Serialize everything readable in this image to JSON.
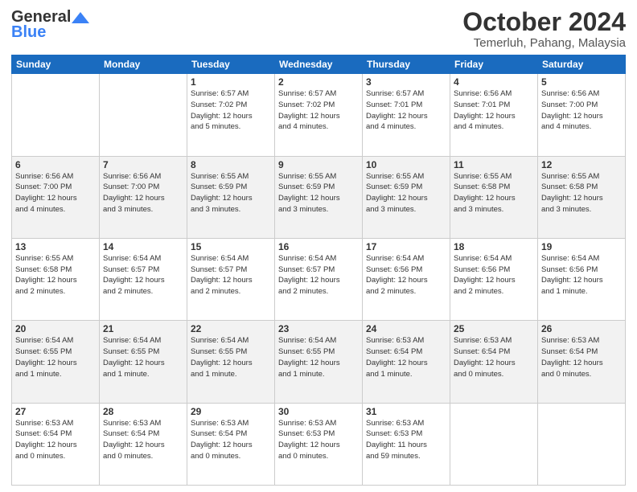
{
  "header": {
    "logo_general": "General",
    "logo_blue": "Blue",
    "month": "October 2024",
    "location": "Temerluh, Pahang, Malaysia"
  },
  "weekdays": [
    "Sunday",
    "Monday",
    "Tuesday",
    "Wednesday",
    "Thursday",
    "Friday",
    "Saturday"
  ],
  "weeks": [
    [
      {
        "day": "",
        "info": ""
      },
      {
        "day": "",
        "info": ""
      },
      {
        "day": "1",
        "info": "Sunrise: 6:57 AM\nSunset: 7:02 PM\nDaylight: 12 hours\nand 5 minutes."
      },
      {
        "day": "2",
        "info": "Sunrise: 6:57 AM\nSunset: 7:02 PM\nDaylight: 12 hours\nand 4 minutes."
      },
      {
        "day": "3",
        "info": "Sunrise: 6:57 AM\nSunset: 7:01 PM\nDaylight: 12 hours\nand 4 minutes."
      },
      {
        "day": "4",
        "info": "Sunrise: 6:56 AM\nSunset: 7:01 PM\nDaylight: 12 hours\nand 4 minutes."
      },
      {
        "day": "5",
        "info": "Sunrise: 6:56 AM\nSunset: 7:00 PM\nDaylight: 12 hours\nand 4 minutes."
      }
    ],
    [
      {
        "day": "6",
        "info": "Sunrise: 6:56 AM\nSunset: 7:00 PM\nDaylight: 12 hours\nand 4 minutes."
      },
      {
        "day": "7",
        "info": "Sunrise: 6:56 AM\nSunset: 7:00 PM\nDaylight: 12 hours\nand 3 minutes."
      },
      {
        "day": "8",
        "info": "Sunrise: 6:55 AM\nSunset: 6:59 PM\nDaylight: 12 hours\nand 3 minutes."
      },
      {
        "day": "9",
        "info": "Sunrise: 6:55 AM\nSunset: 6:59 PM\nDaylight: 12 hours\nand 3 minutes."
      },
      {
        "day": "10",
        "info": "Sunrise: 6:55 AM\nSunset: 6:59 PM\nDaylight: 12 hours\nand 3 minutes."
      },
      {
        "day": "11",
        "info": "Sunrise: 6:55 AM\nSunset: 6:58 PM\nDaylight: 12 hours\nand 3 minutes."
      },
      {
        "day": "12",
        "info": "Sunrise: 6:55 AM\nSunset: 6:58 PM\nDaylight: 12 hours\nand 3 minutes."
      }
    ],
    [
      {
        "day": "13",
        "info": "Sunrise: 6:55 AM\nSunset: 6:58 PM\nDaylight: 12 hours\nand 2 minutes."
      },
      {
        "day": "14",
        "info": "Sunrise: 6:54 AM\nSunset: 6:57 PM\nDaylight: 12 hours\nand 2 minutes."
      },
      {
        "day": "15",
        "info": "Sunrise: 6:54 AM\nSunset: 6:57 PM\nDaylight: 12 hours\nand 2 minutes."
      },
      {
        "day": "16",
        "info": "Sunrise: 6:54 AM\nSunset: 6:57 PM\nDaylight: 12 hours\nand 2 minutes."
      },
      {
        "day": "17",
        "info": "Sunrise: 6:54 AM\nSunset: 6:56 PM\nDaylight: 12 hours\nand 2 minutes."
      },
      {
        "day": "18",
        "info": "Sunrise: 6:54 AM\nSunset: 6:56 PM\nDaylight: 12 hours\nand 2 minutes."
      },
      {
        "day": "19",
        "info": "Sunrise: 6:54 AM\nSunset: 6:56 PM\nDaylight: 12 hours\nand 1 minute."
      }
    ],
    [
      {
        "day": "20",
        "info": "Sunrise: 6:54 AM\nSunset: 6:55 PM\nDaylight: 12 hours\nand 1 minute."
      },
      {
        "day": "21",
        "info": "Sunrise: 6:54 AM\nSunset: 6:55 PM\nDaylight: 12 hours\nand 1 minute."
      },
      {
        "day": "22",
        "info": "Sunrise: 6:54 AM\nSunset: 6:55 PM\nDaylight: 12 hours\nand 1 minute."
      },
      {
        "day": "23",
        "info": "Sunrise: 6:54 AM\nSunset: 6:55 PM\nDaylight: 12 hours\nand 1 minute."
      },
      {
        "day": "24",
        "info": "Sunrise: 6:53 AM\nSunset: 6:54 PM\nDaylight: 12 hours\nand 1 minute."
      },
      {
        "day": "25",
        "info": "Sunrise: 6:53 AM\nSunset: 6:54 PM\nDaylight: 12 hours\nand 0 minutes."
      },
      {
        "day": "26",
        "info": "Sunrise: 6:53 AM\nSunset: 6:54 PM\nDaylight: 12 hours\nand 0 minutes."
      }
    ],
    [
      {
        "day": "27",
        "info": "Sunrise: 6:53 AM\nSunset: 6:54 PM\nDaylight: 12 hours\nand 0 minutes."
      },
      {
        "day": "28",
        "info": "Sunrise: 6:53 AM\nSunset: 6:54 PM\nDaylight: 12 hours\nand 0 minutes."
      },
      {
        "day": "29",
        "info": "Sunrise: 6:53 AM\nSunset: 6:54 PM\nDaylight: 12 hours\nand 0 minutes."
      },
      {
        "day": "30",
        "info": "Sunrise: 6:53 AM\nSunset: 6:53 PM\nDaylight: 12 hours\nand 0 minutes."
      },
      {
        "day": "31",
        "info": "Sunrise: 6:53 AM\nSunset: 6:53 PM\nDaylight: 11 hours\nand 59 minutes."
      },
      {
        "day": "",
        "info": ""
      },
      {
        "day": "",
        "info": ""
      }
    ]
  ]
}
